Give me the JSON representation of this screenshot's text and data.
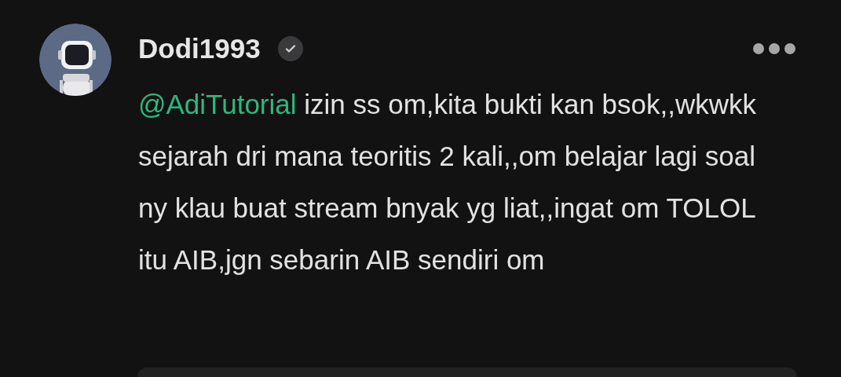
{
  "comment": {
    "author": "Dodi1993",
    "verified": true,
    "mention": "@AdiTutorial",
    "text": " izin ss om,kita bukti kan bsok,,wkwkk sejarah dri mana teoritis 2 kali,,om belajar lagi soal ny klau buat stream bnyak yg liat,,ingat om TOLOL itu AIB,jgn sebarin AIB sendiri om"
  }
}
